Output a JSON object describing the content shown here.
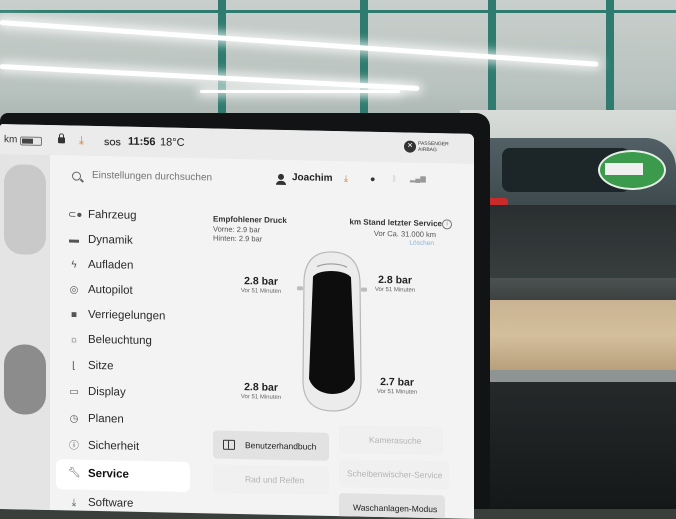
{
  "status_bar": {
    "range_unit": "km",
    "sos": "SOS",
    "time": "11:56",
    "temperature": "18°C",
    "airbag_status": "PASSENGER AIRBAG"
  },
  "search": {
    "placeholder": "Einstellungen durchsuchen"
  },
  "profile": {
    "name": "Joachim"
  },
  "menu": {
    "items": [
      {
        "label": "Fahrzeug",
        "icon": "toggle-icon"
      },
      {
        "label": "Dynamik",
        "icon": "car-icon"
      },
      {
        "label": "Aufladen",
        "icon": "bolt-icon"
      },
      {
        "label": "Autopilot",
        "icon": "steering-wheel-icon"
      },
      {
        "label": "Verriegelungen",
        "icon": "lock-icon"
      },
      {
        "label": "Beleuchtung",
        "icon": "sun-icon"
      },
      {
        "label": "Sitze",
        "icon": "seat-icon"
      },
      {
        "label": "Display",
        "icon": "display-icon"
      },
      {
        "label": "Planen",
        "icon": "alarm-clock-icon"
      },
      {
        "label": "Sicherheit",
        "icon": "info-circle-icon"
      },
      {
        "label": "Service",
        "icon": "wrench-icon",
        "active": true
      },
      {
        "label": "Software",
        "icon": "download-icon"
      }
    ]
  },
  "tire_pressure": {
    "recommended_title": "Empfohlener Druck",
    "front": "Vorne: 2.9 bar",
    "rear": "Hinten: 2.9 bar",
    "front_left": {
      "value": "2.8 bar",
      "sub": "Vor 51 Minuten"
    },
    "front_right": {
      "value": "2.8 bar",
      "sub": "Vor 51 Minuten"
    },
    "rear_left": {
      "value": "2.8 bar",
      "sub": "Vor 51 Minuten"
    },
    "rear_right": {
      "value": "2.7 bar",
      "sub": "Vor 51 Minuten"
    }
  },
  "service": {
    "title": "km Stand letzter Service",
    "value": "Vor Ca. 31.000 km",
    "link": "Löschen"
  },
  "buttons": {
    "manual": "Benutzerhandbuch",
    "camera": "Kamerasuche",
    "wheels": "Rad und Reifen",
    "wiper": "Scheibenwischer-Service",
    "carwash": "Waschanlagen-Modus"
  }
}
